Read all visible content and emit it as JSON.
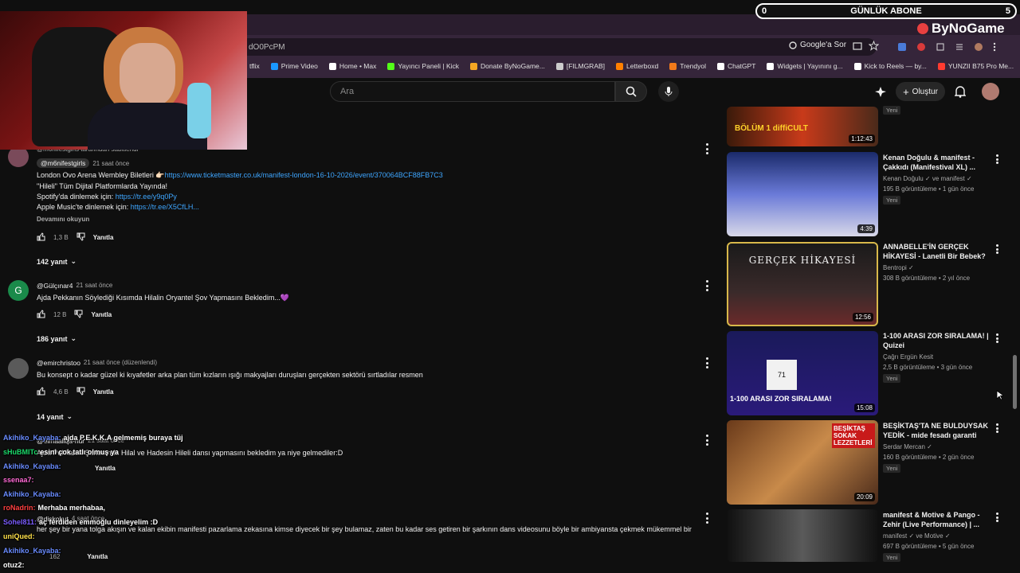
{
  "overlay": {
    "sub_left": "0",
    "sub_title": "GÜNLÜK ABONE",
    "sub_right": "5",
    "brand": "ByNoGame"
  },
  "browser": {
    "url": "dO0PcPM",
    "google_sor": "Google'a Sor",
    "bookmarks": [
      {
        "label": "tflix",
        "color": "#e50914"
      },
      {
        "label": "Prime Video",
        "color": "#1a98ff"
      },
      {
        "label": "Home • Max",
        "color": "#ffffff"
      },
      {
        "label": "Yayıncı Paneli | Kick",
        "color": "#53fc18"
      },
      {
        "label": "Donate ByNoGame...",
        "color": "#f5a623"
      },
      {
        "label": "[FILMGRAB]",
        "color": "#cccccc"
      },
      {
        "label": "Letterboxd",
        "color": "#ff8000"
      },
      {
        "label": "Trendyol",
        "color": "#f27a1a"
      },
      {
        "label": "ChatGPT",
        "color": "#ffffff"
      },
      {
        "label": "Widgets | Yayınını g...",
        "color": "#ffffff"
      },
      {
        "label": "Kick to Reels — by...",
        "color": "#ffffff"
      },
      {
        "label": "YUNZII B75 Pro Me...",
        "color": "#ff3b30"
      }
    ]
  },
  "youtube": {
    "search_placeholder": "Ara",
    "create_label": "Oluştur"
  },
  "comments": [
    {
      "pinned_by": "@m6nifestgirls tarafından sabitlendi",
      "handle": "@m6nifestgirls",
      "time": "21 saat önce",
      "line1": "London Ovo Arena Wembley Biletleri 👉🏻",
      "line1_link": "https://www.ticketmaster.co.uk/manifest-london-16-10-2026/event/370064BCF88FB7C3",
      "line2": "\"Hileli\" Tüm Dijital Platformlarda Yayında!",
      "line3": "Spotify'da dinlemek için:",
      "line3_link": "https://tr.ee/y9q0Py",
      "line4": "Apple Music'te dinlemek için:",
      "line4_link": "https://tr.ee/X5CfLH...",
      "more": "Devamını okuyun",
      "likes": "1,3 B",
      "reply": "Yanıtla",
      "replies": "142 yanıt"
    },
    {
      "handle": "@Gülçınar4",
      "time": "21 saat önce",
      "text": "Ajda Pekkanın Söylediği Kısımda Hilalin Oryantel Şov Yapmasını Bekledim...💜",
      "likes": "12 B",
      "reply": "Yanıtla",
      "replies": "186 yanıt",
      "avatar_letter": "G"
    },
    {
      "handle": "@emirchristoo",
      "time": "21 saat önce (düzenlendi)",
      "text": "Bu konsept o kadar güzel ki kıyafetler arka plan tüm kızların ışığı makyajları duruşları gerçekten sektörü sırtladılar resmen",
      "likes": "4,6 B",
      "reply": "Yanıtla",
      "replies": "14 yanıt"
    },
    {
      "handle": "@elmaaliqa-nur",
      "time": "21 saat önce",
      "text": "Ajda Pekkanın Şarkısında Hilal ve Hadesin Hileli dansı yapmasını bekledim ya niye gelmediler:D",
      "reply": "Yanıtla"
    },
    {
      "handle": "@diskokut",
      "time": "4 saat önce",
      "text": "her şey bir yana tolga akışın ve kalan ekibin manifesti pazarlama zekasına kimse diyecek bir şey bulamaz, zaten bu kadar ses getiren bir şarkının dans videosunu böyle bir ambiyansta çekmek mükemmel bir",
      "likes": "162",
      "reply": "Yanıtla"
    }
  ],
  "sidebar": [
    {
      "title": "",
      "duration": "1:12:43",
      "channel": "",
      "stats": "",
      "badge": "Yeni",
      "thumb_text": "BÖLÜM 1 diffiCULT"
    },
    {
      "title": "Kenan Doğulu & manifest - Çakkıdı (Manifestival XL) ...",
      "duration": "4:39",
      "channel": "Kenan Doğulu ✓ ve manifest ✓",
      "stats": "195 B görüntüleme • 1 gün önce",
      "badge": "Yeni",
      "thumb_text": ""
    },
    {
      "title": "ANNABELLE'İN GERÇEK HİKAYESİ - Lanetli Bir Bebek?",
      "duration": "12:56",
      "channel": "Bentropi ✓",
      "stats": "308 B görüntüleme • 2 yıl önce",
      "badge": "",
      "thumb_text": "GERÇEK HİKAYESİ"
    },
    {
      "title": "1-100 ARASI ZOR SIRALAMA! | Quizei",
      "duration": "15:08",
      "channel": "Çağrı Ergün Kesit",
      "stats": "2,5 B görüntüleme • 3 gün önce",
      "badge": "Yeni",
      "thumb_text": "1-100 ARASI ZOR SIRALAMA!"
    },
    {
      "title": "BEŞİKTAŞ'TA NE BULDUYSAK YEDİK - mide fesadı garanti",
      "duration": "20:09",
      "channel": "Serdar Mercan ✓",
      "stats": "160 B görüntüleme • 2 gün önce",
      "badge": "Yeni",
      "thumb_text": "BEŞİKTAŞ SOKAK LEZZETLERİ"
    },
    {
      "title": "manifest & Motive & Pango - Zehir (Live Performance) | ...",
      "duration": "",
      "channel": "manifest ✓ ve Motive ✓",
      "stats": "697 B görüntüleme • 5 gün önce",
      "badge": "Yeni",
      "thumb_text": ""
    }
  ],
  "chat": [
    {
      "user": "Akihiko_Kayaba:",
      "msg": "ajda P.E.K.K.A gelmemiş buraya tüj",
      "color": "#6a8cff"
    },
    {
      "user": "sHuBMITc",
      "msg": "esini çok tatlı olmuş ya",
      "color": "#1bd96a"
    },
    {
      "user": "Akihiko_Kayaba:",
      "msg": "",
      "color": "#6a8cff"
    },
    {
      "user": "ssenaa7:",
      "msg": "",
      "color": "#ff6ad5"
    },
    {
      "user": "Akihiko_Kayaba:",
      "msg": "",
      "color": "#6a8cff"
    },
    {
      "user": "roNadrin:",
      "msg": "Merhaba merhabaa,",
      "color": "#ff4040"
    },
    {
      "user": "Sohel811:",
      "msg": "aç ferdiden emmoğlu dinleyelim :D",
      "color": "#7b5cff"
    },
    {
      "user": "uniQued:",
      "msg": "",
      "color": "#ffe14a"
    },
    {
      "user": "Akihiko_Kayaba:",
      "msg": "",
      "color": "#6a8cff"
    },
    {
      "user": "otuz2:",
      "msg": "",
      "color": "#ffffff"
    }
  ]
}
